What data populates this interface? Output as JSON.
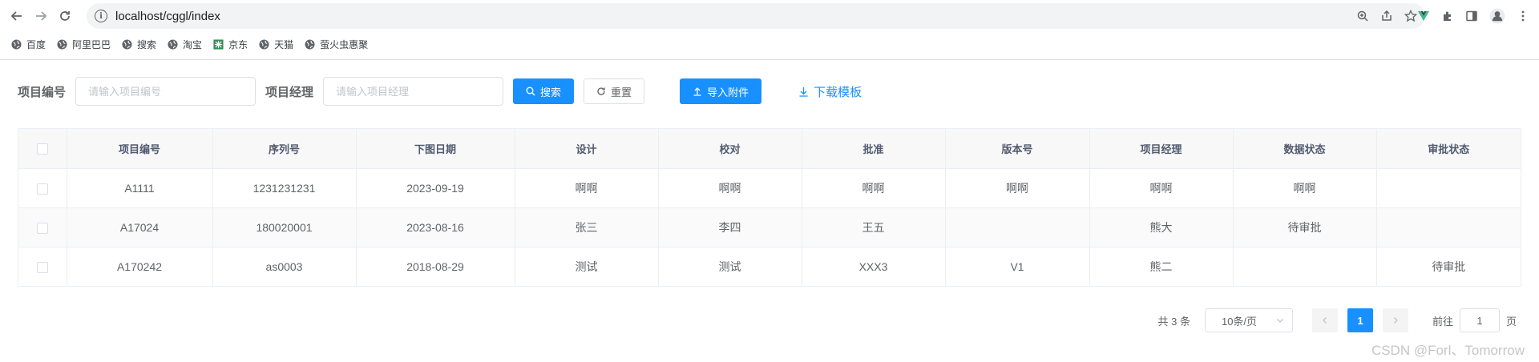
{
  "browser": {
    "url": "localhost/cggl/index",
    "bookmarks": [
      {
        "label": "百度",
        "icon": "globe-icon"
      },
      {
        "label": "阿里巴巴",
        "icon": "globe-icon"
      },
      {
        "label": "搜索",
        "icon": "globe-icon"
      },
      {
        "label": "淘宝",
        "icon": "globe-icon"
      },
      {
        "label": "京东",
        "icon": "jd-icon"
      },
      {
        "label": "天猫",
        "icon": "globe-icon"
      },
      {
        "label": "萤火虫惠聚",
        "icon": "globe-icon"
      }
    ]
  },
  "search": {
    "project_no_label": "项目编号",
    "project_no_placeholder": "请输入项目编号",
    "manager_label": "项目经理",
    "manager_placeholder": "请输入项目经理",
    "search_button": "搜索",
    "reset_button": "重置",
    "import_button": "导入附件",
    "download_link": "下载模板"
  },
  "table": {
    "columns": [
      "项目编号",
      "序列号",
      "下图日期",
      "设计",
      "校对",
      "批准",
      "版本号",
      "项目经理",
      "数据状态",
      "审批状态"
    ],
    "rows": [
      [
        "A1111",
        "1231231231",
        "2023-09-19",
        "啊啊",
        "啊啊",
        "啊啊",
        "啊啊",
        "啊啊",
        "啊啊",
        ""
      ],
      [
        "A17024",
        "180020001",
        "2023-08-16",
        "张三",
        "李四",
        "王五",
        "",
        "熊大",
        "待审批",
        ""
      ],
      [
        "A170242",
        "as0003",
        "2018-08-29",
        "测试",
        "测试",
        "XXX3",
        "V1",
        "熊二",
        "",
        "待审批"
      ]
    ]
  },
  "pagination": {
    "total": "共 3 条",
    "page_size": "10条/页",
    "current_page": "1",
    "goto_label": "前往",
    "goto_value": "1",
    "goto_suffix": "页"
  },
  "watermark": "CSDN @Forl、Tomorrow",
  "colors": {
    "primary": "#1890ff",
    "border": "#dcdfe6",
    "header_bg": "#f8f8f9"
  }
}
